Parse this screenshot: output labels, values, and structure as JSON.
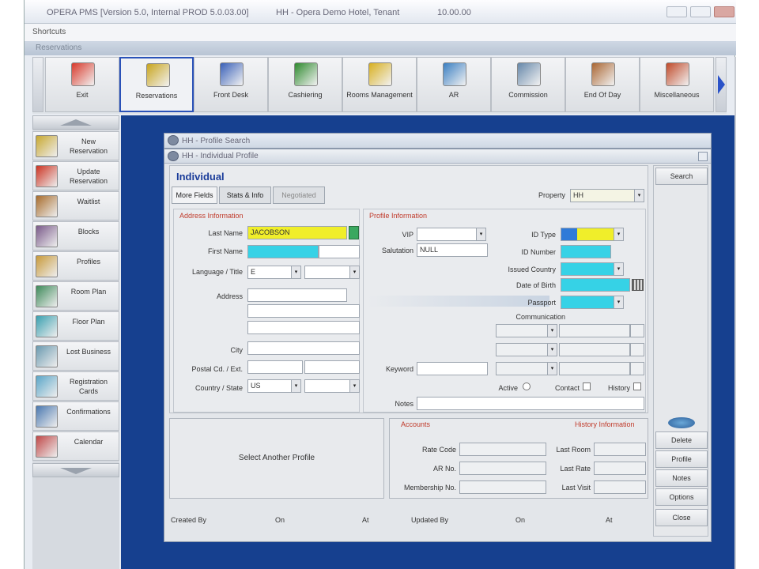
{
  "window": {
    "title": "OPERA PMS [Version 5.0, Internal PROD 5.0.03.00]",
    "subtitle": "HH - Opera Demo Hotel, Tenant",
    "date": "10.00.00"
  },
  "menubar": {
    "label": "Shortcuts"
  },
  "subbar": {
    "label": "Reservations"
  },
  "toolbar": [
    {
      "label": "Exit",
      "icon": "exit-door-icon",
      "color": "#d8392b"
    },
    {
      "label": "Reservations",
      "icon": "reservations-icon",
      "color": "#c8a51e"
    },
    {
      "label": "Front Desk",
      "icon": "front-desk-icon",
      "color": "#3960b8"
    },
    {
      "label": "Cashiering",
      "icon": "cashiering-icon",
      "color": "#2e8a2e"
    },
    {
      "label": "Rooms Management",
      "icon": "rooms-management-icon",
      "color": "#d8b020"
    },
    {
      "label": "AR",
      "icon": "ar-icon",
      "color": "#3a7fc2"
    },
    {
      "label": "Commission",
      "icon": "commission-icon",
      "color": "#6688aa"
    },
    {
      "label": "End Of Day",
      "icon": "end-of-day-icon",
      "color": "#aa6633"
    },
    {
      "label": "Miscellaneous",
      "icon": "miscellaneous-icon",
      "color": "#c04a2a"
    }
  ],
  "leftnav": [
    {
      "label": "New Reservation",
      "icon": "new-reservation-icon",
      "color": "#c8a830"
    },
    {
      "label": "Update Reservation",
      "icon": "update-reservation-icon",
      "color": "#cc3322"
    },
    {
      "label": "Waitlist",
      "icon": "waitlist-icon",
      "color": "#a86c2c"
    },
    {
      "label": "Blocks",
      "icon": "blocks-icon",
      "color": "#7a5a8a"
    },
    {
      "label": "Profiles",
      "icon": "profiles-icon",
      "color": "#c89a3a"
    },
    {
      "label": "Room Plan",
      "icon": "room-plan-icon",
      "color": "#3e8a5a"
    },
    {
      "label": "Floor Plan",
      "icon": "floor-plan-icon",
      "color": "#3aa0b0"
    },
    {
      "label": "Lost Business",
      "icon": "lost-business-icon",
      "color": "#6a9ab0"
    },
    {
      "label": "Registration Cards",
      "icon": "registration-cards-icon",
      "color": "#5aa6c8"
    },
    {
      "label": "Confirmations",
      "icon": "confirmations-icon",
      "color": "#4a78b0"
    },
    {
      "label": "Calendar",
      "icon": "calendar-icon",
      "color": "#c04848"
    }
  ],
  "dialog_back": {
    "title": "HH - Profile Search"
  },
  "dialog": {
    "title": "HH - Individual Profile",
    "header": "Individual",
    "tabs": [
      "More Fields",
      "Stats & Info",
      "Negotiated"
    ],
    "property_label": "Property",
    "property_value": "HH",
    "sections": {
      "address": "Address Information",
      "profile": "Profile Information",
      "accounts": "Accounts",
      "history": "History Information"
    },
    "fields": {
      "last_name_label": "Last Name",
      "last_name_value": "JACOBSON",
      "first_name_label": "First Name",
      "language_label": "Language / Title",
      "language_value": "E",
      "address_label": "Address",
      "city_label": "City",
      "postal_label": "Postal Cd. / Ext.",
      "country_label": "Country / State",
      "country_value": "US",
      "vip_label": "VIP",
      "salutation_label": "Salutation",
      "salutation_value": "NULL",
      "id_type_label": "ID Type",
      "id_number_label": "ID Number",
      "issued_country_label": "Issued Country",
      "dob_label": "Date of Birth",
      "passport_label": "Passport",
      "communication_label": "Communication",
      "keyword_label": "Keyword",
      "active_label": "Active",
      "contact_label": "Contact",
      "history_label": "History",
      "notes_label": "Notes",
      "select_profile_label": "Select Another Profile",
      "rate_code_label": "Rate Code",
      "ar_no_label": "AR No.",
      "membership_label": "Membership No.",
      "last_room_label": "Last Room",
      "last_rate_label": "Last Rate",
      "last_visit_label": "Last Visit"
    },
    "status": {
      "created_by": "Created By",
      "on1": "On",
      "at1": "At",
      "updated_by": "Updated By",
      "on2": "On",
      "at2": "At"
    },
    "right_buttons": [
      "Search",
      "Delete",
      "Profile",
      "Notes",
      "Options",
      "Close"
    ],
    "right_top_button": "Search"
  }
}
